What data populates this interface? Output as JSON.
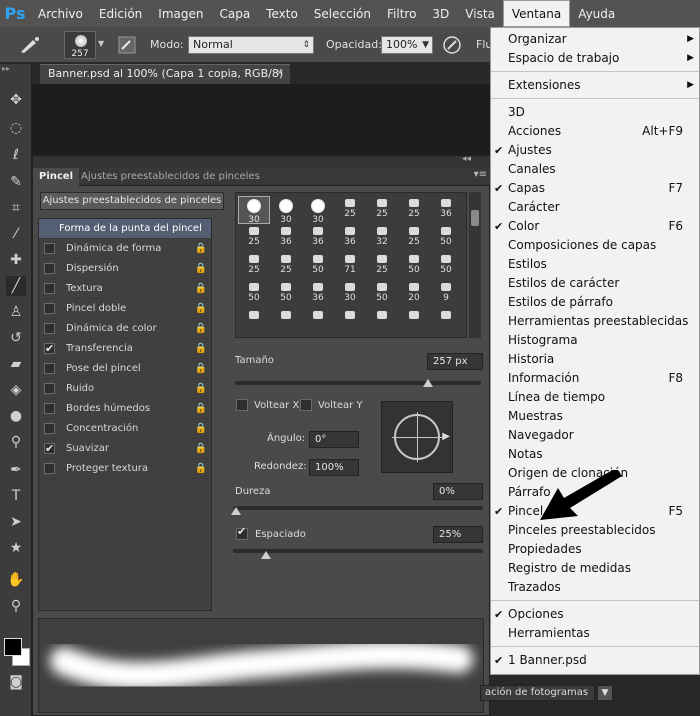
{
  "app": {
    "logo": "Ps"
  },
  "menubar": {
    "items": [
      "Archivo",
      "Edición",
      "Imagen",
      "Capa",
      "Texto",
      "Selección",
      "Filtro",
      "3D",
      "Vista",
      "Ventana",
      "Ayuda"
    ],
    "active": "Ventana"
  },
  "options": {
    "brush_size": "257",
    "mode_label": "Modo:",
    "mode_value": "Normal",
    "opacity_label": "Opacidad:",
    "opacity_value": "100%",
    "flow_label_partial": "Flu"
  },
  "document": {
    "tab_title": "Banner.psd al 100% (Capa 1 copia, RGB/8)"
  },
  "brush_panel": {
    "tabs": [
      "Pincel",
      "Ajustes preestablecidos de pinceles"
    ],
    "presets_button": "Ajustes preestablecidos de pinceles",
    "list": [
      {
        "label": "Forma de la punta del pincel",
        "checked": null,
        "selected": true
      },
      {
        "label": "Dinámica de forma",
        "checked": false
      },
      {
        "label": "Dispersión",
        "checked": false
      },
      {
        "label": "Textura",
        "checked": false
      },
      {
        "label": "Pincel doble",
        "checked": false
      },
      {
        "label": "Dinámica de color",
        "checked": false
      },
      {
        "label": "Transferencia",
        "checked": true
      },
      {
        "label": "Pose del pincel",
        "checked": false
      },
      {
        "label": "Ruido",
        "checked": false
      },
      {
        "label": "Bordes húmedos",
        "checked": false
      },
      {
        "label": "Concentración",
        "checked": false
      },
      {
        "label": "Suavizar",
        "checked": true
      },
      {
        "label": "Proteger textura",
        "checked": false
      }
    ],
    "tips": [
      [
        "30",
        "30",
        "30",
        "25",
        "25",
        "25",
        "36"
      ],
      [
        "25",
        "36",
        "36",
        "36",
        "32",
        "25",
        "50"
      ],
      [
        "25",
        "25",
        "50",
        "71",
        "25",
        "50",
        "50"
      ],
      [
        "50",
        "50",
        "36",
        "30",
        "50",
        "20",
        "9"
      ],
      [
        "",
        "",
        "",
        "",
        "",
        "",
        ""
      ]
    ],
    "size_label": "Tamaño",
    "size_value": "257 px",
    "flip_x": "Voltear X",
    "flip_y": "Voltear Y",
    "angle_label": "Ángulo:",
    "angle_value": "0°",
    "roundness_label": "Redondez:",
    "roundness_value": "100%",
    "hardness_label": "Dureza",
    "hardness_value": "0%",
    "spacing_label": "Espaciado",
    "spacing_value": "25%"
  },
  "window_menu": {
    "items": [
      {
        "label": "Organizar",
        "submenu": true
      },
      {
        "label": "Espacio de trabajo",
        "submenu": true
      },
      {
        "sep": true
      },
      {
        "label": "Extensiones",
        "submenu": true
      },
      {
        "sep": true
      },
      {
        "label": "3D"
      },
      {
        "label": "Acciones",
        "shortcut": "Alt+F9"
      },
      {
        "label": "Ajustes",
        "checked": true
      },
      {
        "label": "Canales"
      },
      {
        "label": "Capas",
        "checked": true,
        "shortcut": "F7"
      },
      {
        "label": "Carácter"
      },
      {
        "label": "Color",
        "checked": true,
        "shortcut": "F6"
      },
      {
        "label": "Composiciones de capas"
      },
      {
        "label": "Estilos"
      },
      {
        "label": "Estilos de carácter"
      },
      {
        "label": "Estilos de párrafo"
      },
      {
        "label": "Herramientas preestablecidas"
      },
      {
        "label": "Histograma"
      },
      {
        "label": "Historia"
      },
      {
        "label": "Información",
        "shortcut": "F8"
      },
      {
        "label": "Línea de tiempo"
      },
      {
        "label": "Muestras"
      },
      {
        "label": "Navegador"
      },
      {
        "label": "Notas"
      },
      {
        "label": "Origen de clonación"
      },
      {
        "label": "Párrafo"
      },
      {
        "label": "Pincel",
        "checked": true,
        "shortcut": "F5"
      },
      {
        "label": "Pinceles preestablecidos"
      },
      {
        "label": "Propiedades"
      },
      {
        "label": "Registro de medidas"
      },
      {
        "label": "Trazados"
      },
      {
        "sep": true
      },
      {
        "label": "Opciones",
        "checked": true
      },
      {
        "label": "Herramientas"
      },
      {
        "sep": true
      },
      {
        "label": "1 Banner.psd",
        "checked": true
      }
    ]
  },
  "bottom": {
    "timeline_button": "ación de fotogramas"
  },
  "colors": {
    "accent": "#2fa3f5",
    "menu_bg": "#f2f2f2",
    "selected_row": "#545f74"
  }
}
